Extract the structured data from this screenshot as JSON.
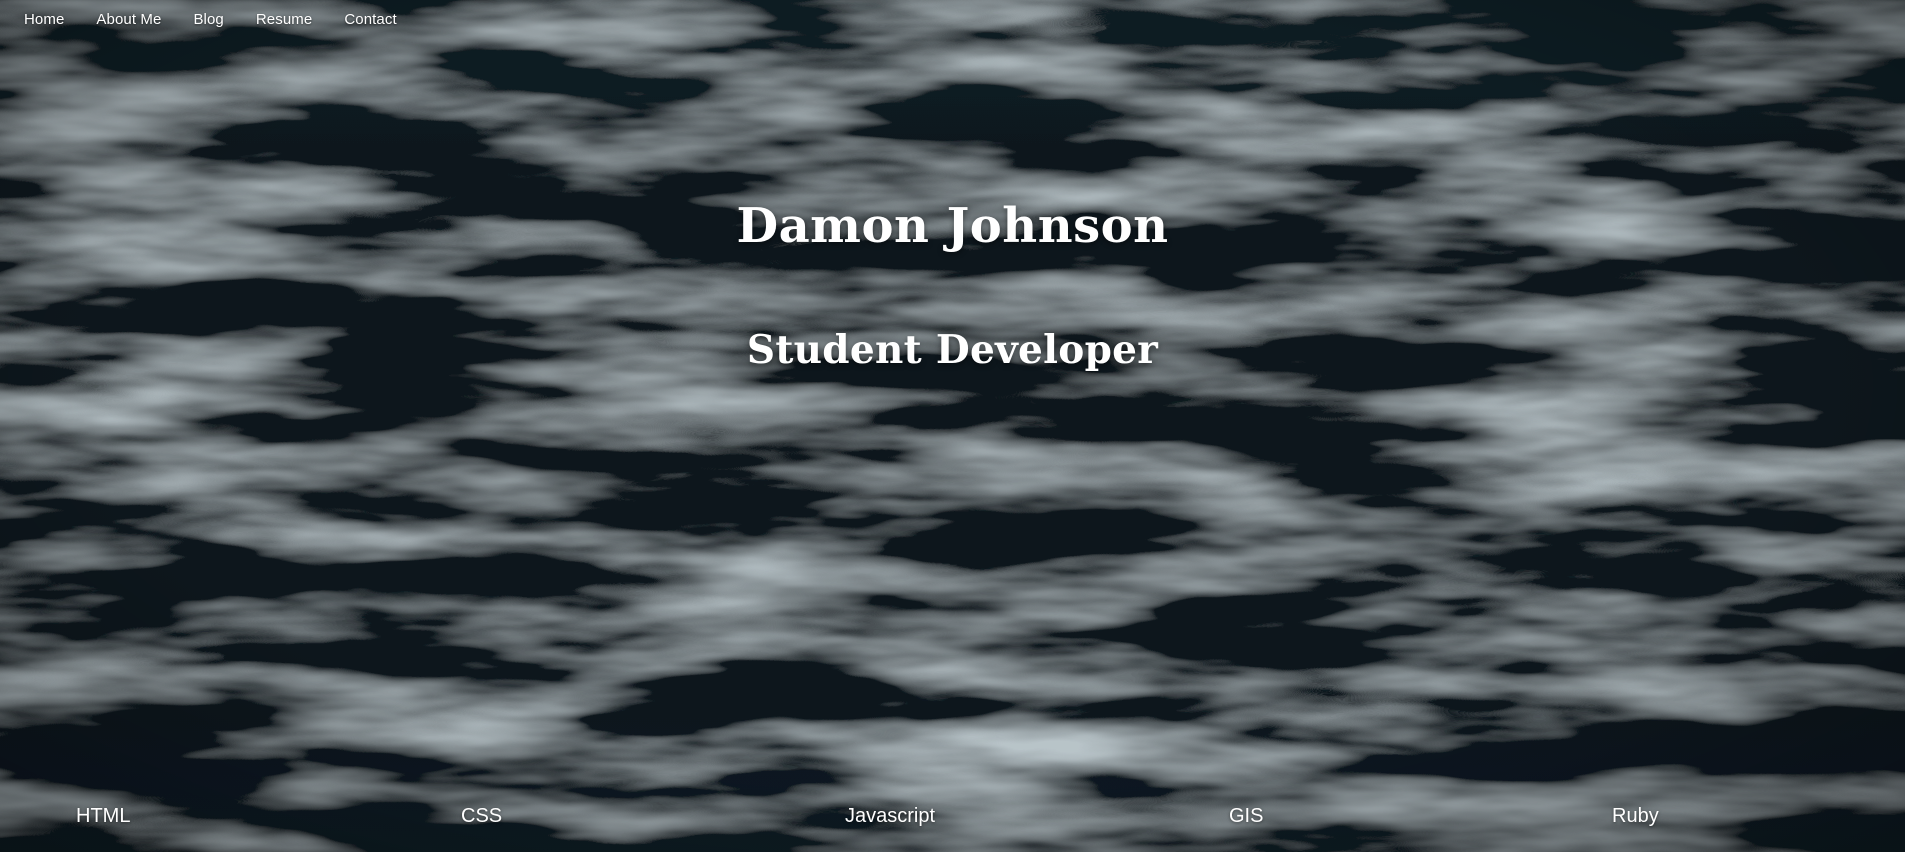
{
  "nav": {
    "items": [
      {
        "label": "Home"
      },
      {
        "label": "About Me"
      },
      {
        "label": "Blog"
      },
      {
        "label": "Resume"
      },
      {
        "label": "Contact"
      }
    ]
  },
  "hero": {
    "title": "Damon Johnson",
    "subtitle": "Student Developer"
  },
  "skills": {
    "items": [
      "HTML",
      "CSS",
      "Javascript",
      "GIS",
      "Ruby"
    ]
  },
  "colors": {
    "text": "#ffffff",
    "background": "#0b141a"
  }
}
